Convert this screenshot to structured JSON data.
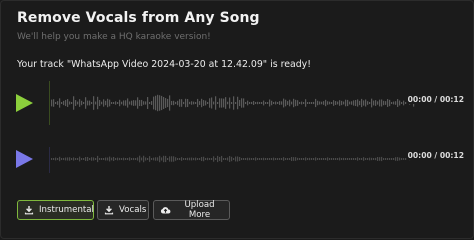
{
  "header": {
    "title": "Remove Vocals from Any Song",
    "subtitle": "We'll help you make a HQ karaoke version!"
  },
  "status": {
    "message": "Your track \"WhatsApp Video 2024-03-20 at 12.42.09\" is ready!"
  },
  "tracks": [
    {
      "name": "instrumental",
      "time": "00:00 / 00:12",
      "progress": 0,
      "color": "#8ccf3c"
    },
    {
      "name": "vocals",
      "time": "00:00 / 00:12",
      "progress": 0,
      "color": "#7a78e8"
    }
  ],
  "buttons": {
    "instrumental": {
      "label": "Instrumental",
      "icon": "download-icon"
    },
    "vocals": {
      "label": "Vocals",
      "icon": "download-icon"
    },
    "upload": {
      "label": "Upload More",
      "icon": "cloud-upload-icon"
    }
  }
}
